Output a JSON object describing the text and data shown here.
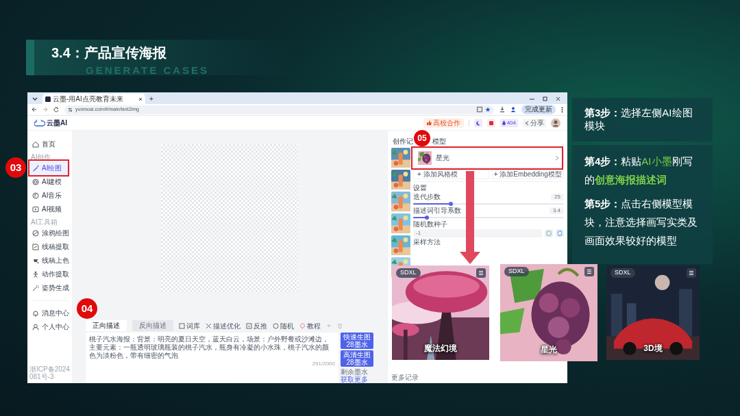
{
  "slide": {
    "title": "3.4：产品宣传海报",
    "subtitle": "GENERATE CASES"
  },
  "browser": {
    "tab_title": "云墨-用AI点亮教育未来",
    "new_tab": "+",
    "url": "yunmoai.com/#/main/text2img",
    "update_button": "完成更新"
  },
  "app": {
    "logo": "云墨AI",
    "header": {
      "partner_button": "高校合作",
      "ink_count": "404",
      "share": "分享"
    },
    "sidebar": {
      "sections": [
        {
          "items": [
            {
              "label": "首页",
              "selected": false
            }
          ]
        },
        {
          "heading": "AI创作",
          "items": [
            {
              "label": "AI绘图",
              "selected": true
            },
            {
              "label": "AI建模",
              "selected": false
            },
            {
              "label": "AI音乐",
              "selected": false
            },
            {
              "label": "AI视频",
              "selected": false
            }
          ]
        },
        {
          "heading": "AI工具箱",
          "items": [
            {
              "label": "涂鸦绘图",
              "selected": false
            },
            {
              "label": "线稿提取",
              "selected": false
            },
            {
              "label": "线稿上色",
              "selected": false
            },
            {
              "label": "动作提取",
              "selected": false
            },
            {
              "label": "姿势生成",
              "selected": false
            }
          ]
        },
        {
          "items": [
            {
              "label": "消息中心",
              "selected": false
            },
            {
              "label": "个人中心",
              "selected": false
            }
          ]
        }
      ],
      "footer": "浙ICP备2024081号-3"
    },
    "prompt": {
      "tabs": [
        {
          "label": "正向描述",
          "selected": true
        },
        {
          "label": "反向描述",
          "selected": false
        }
      ],
      "tools": [
        "词库",
        "描述优化",
        "反推",
        "随机",
        "教程"
      ],
      "text": "桃子汽水海报：背景：明亮的夏日天空，蓝天白云，场景：户外野餐或沙滩边，主要元素：一瓶透明玻璃瓶装的桃子汽水，瓶身有冷凝的小水珠，桃子汽水的颜色为淡粉色，带有细密的气泡",
      "counter": "291/2000",
      "buttons": [
        {
          "label": "快速生图",
          "cost": "28墨水"
        },
        {
          "label": "高清生图",
          "cost": "28墨水"
        }
      ],
      "ink_note": "剩余墨水",
      "ink_link": "获取更多"
    },
    "panel": {
      "history_label": "创作记",
      "model_label": "模型",
      "model": {
        "name": "星光"
      },
      "add_buttons": [
        "+ 添加风格模",
        "+ 添加Embedding模型"
      ],
      "settings_title": "设置",
      "sliders": [
        {
          "label": "迭代步数",
          "reading": "25",
          "level": 0.25
        },
        {
          "label": "描述词引导系数",
          "reading": "3.4",
          "level": 0.09
        }
      ],
      "seed": {
        "label": "随机数种子",
        "value": "-1"
      },
      "sampler_label": "采样方法",
      "more_history": "更多记录"
    }
  },
  "callouts": [
    "03",
    "04",
    "05"
  ],
  "model_cards": [
    {
      "badge": "SDXL",
      "name": "魔法幻境"
    },
    {
      "badge": "SDXL",
      "name": "星光"
    },
    {
      "badge": "SDXL",
      "name": "3D境"
    }
  ],
  "steps": [
    {
      "parts": [
        {
          "text": "第3步：",
          "kind": "lead"
        },
        {
          "text": "选择左侧AI绘图模块",
          "kind": "plain"
        }
      ]
    },
    {
      "parts": [
        {
          "text": "第4步：",
          "kind": "lead"
        },
        {
          "text": "粘贴",
          "kind": "plain"
        },
        {
          "text": "AI小墨",
          "kind": "accent"
        },
        {
          "text": "刚写的",
          "kind": "plain"
        },
        {
          "text": "创意海报描述词",
          "kind": "accent_bold"
        }
      ]
    },
    {
      "parts": [
        {
          "text": "第5步：",
          "kind": "lead"
        },
        {
          "text": "点击右侧模型模块，注意选择画写实类及画面效果较好的模型",
          "kind": "plain"
        }
      ]
    }
  ]
}
